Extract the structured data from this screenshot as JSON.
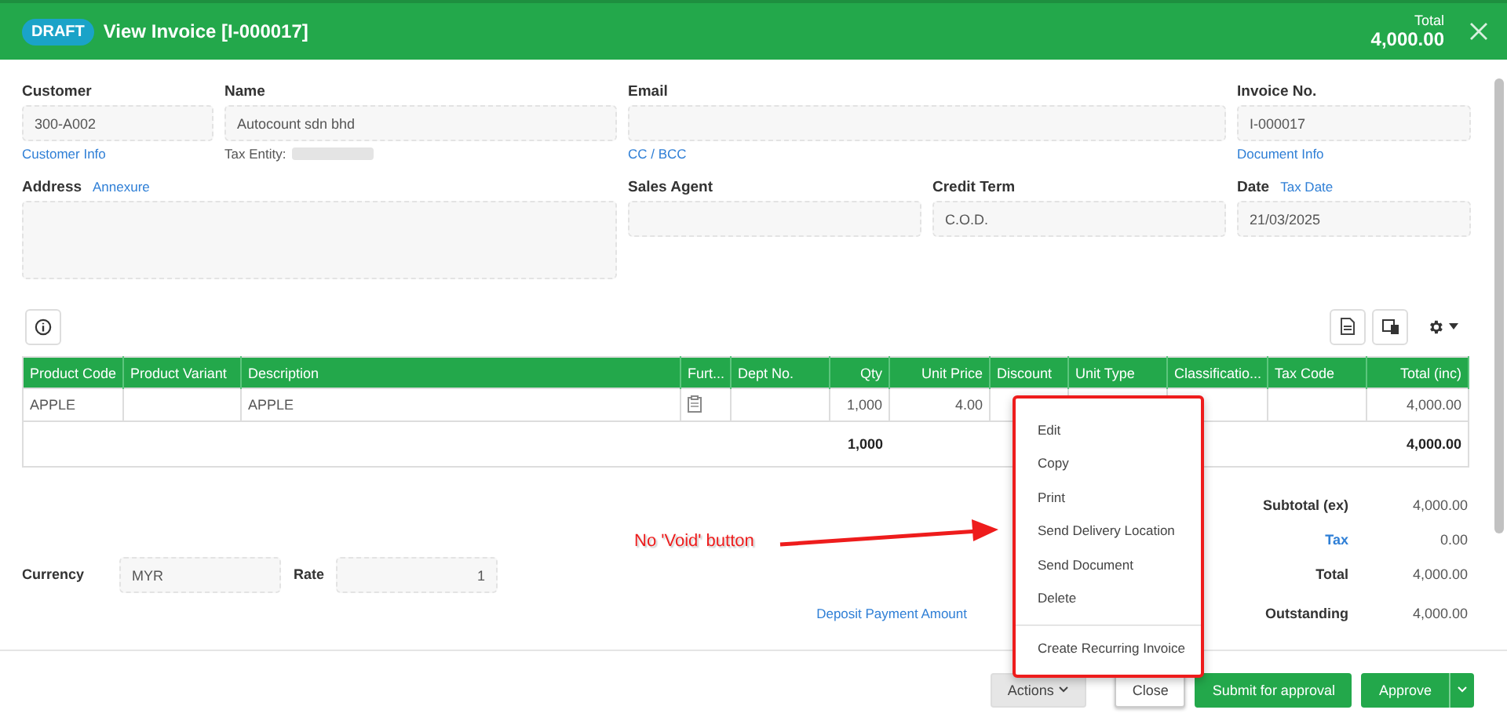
{
  "header": {
    "status_badge": "DRAFT",
    "title": "View Invoice [I-000017]",
    "total_label": "Total",
    "total_value": "4,000.00"
  },
  "fields": [
    {
      "label": "Customer",
      "value": "300-A002",
      "link": "Customer Info"
    },
    {
      "label": "Name",
      "value": "Autocount sdn bhd",
      "note": "Tax Entity:"
    },
    {
      "label": "Email",
      "link": "CC / BCC"
    },
    {
      "label": "Invoice No.",
      "value": "I-000017",
      "link": "Document Info"
    },
    {
      "label": "Address",
      "label_link": "Annexure"
    },
    {
      "label": "Sales Agent"
    },
    {
      "label": "Credit Term",
      "value": "C.O.D."
    },
    {
      "label": "Date",
      "label_link": "Tax Date",
      "value": "21/03/2025"
    }
  ],
  "table": {
    "columns": [
      "Product Code",
      "Product Variant",
      "Description",
      "Furt...",
      "Dept No.",
      "Qty",
      "Unit Price",
      "Discount",
      "Unit Type",
      "Classificatio...",
      "Tax Code",
      "Total (inc)"
    ],
    "rows": [
      [
        "APPLE",
        "",
        "APPLE",
        "",
        "",
        "1,000",
        "4.00",
        "",
        "",
        "",
        "",
        "4,000.00"
      ]
    ],
    "totals": {
      "qty": "1,000",
      "total": "4,000.00"
    }
  },
  "currency": {
    "label": "Currency",
    "value": "MYR",
    "rate_label": "Rate",
    "rate_value": "1"
  },
  "deposit_link": "Deposit Payment Amount",
  "summary": [
    {
      "label": "Subtotal (ex)",
      "value": "4,000.00",
      "link": false
    },
    {
      "label": "Tax",
      "value": "0.00",
      "link": true
    },
    {
      "label": "Total",
      "value": "4,000.00",
      "link": false
    },
    {
      "label": "Outstanding",
      "value": "4,000.00",
      "link": false
    }
  ],
  "actions_menu": {
    "items": [
      "Edit",
      "Copy",
      "Print",
      "Send Delivery Location",
      "Send Document",
      "Delete"
    ],
    "extra_items": [
      "Create Recurring Invoice"
    ]
  },
  "annotation": "No 'Void' button",
  "footer": {
    "actions": "Actions",
    "close": "Close",
    "submit": "Submit for approval",
    "approve": "Approve"
  }
}
